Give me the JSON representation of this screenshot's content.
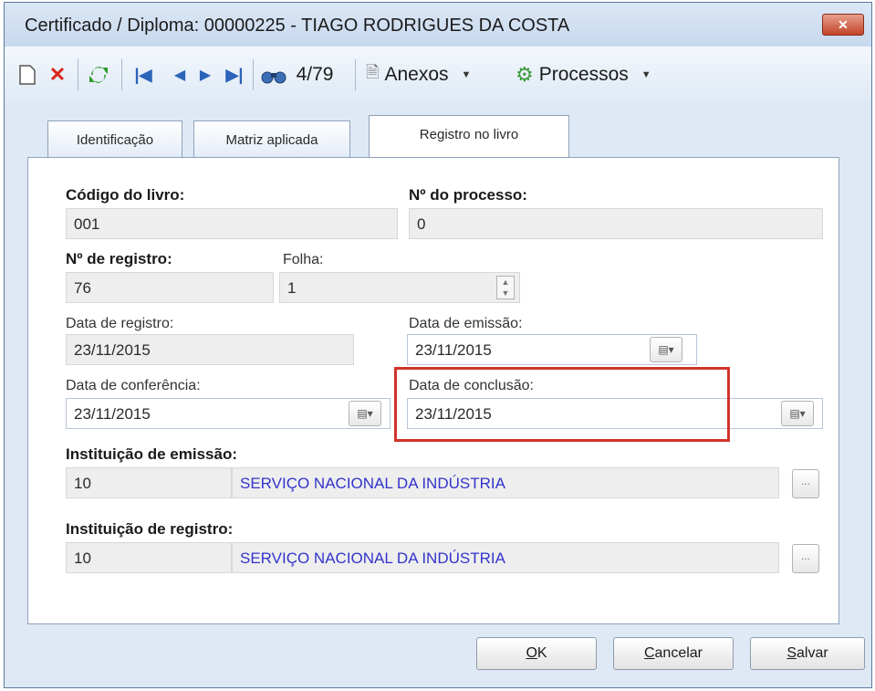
{
  "window": {
    "title": "Certificado / Diploma: 00000225 - TIAGO RODRIGUES DA COSTA",
    "close_label": "✕"
  },
  "toolbar": {
    "icons": [
      "new-document-icon",
      "delete-icon",
      "refresh-icon",
      "first-record-icon",
      "previous-record-icon",
      "next-record-icon",
      "last-record-icon",
      "binoculars-icon"
    ],
    "record_counter": "4/79",
    "attachments_label": "Anexos",
    "processes_label": "Processos"
  },
  "tabs": [
    {
      "label": "Identificação",
      "active": false
    },
    {
      "label": "Matriz aplicada",
      "active": false
    },
    {
      "label": "Registro no livro",
      "active": true
    }
  ],
  "form": {
    "book_code": {
      "label": "Código do livro:",
      "value": "001"
    },
    "process_number": {
      "label": "Nº do processo:",
      "value": "0"
    },
    "registration_number": {
      "label": "Nº de registro:",
      "value": "76"
    },
    "sheet": {
      "label": "Folha:",
      "value": "1"
    },
    "registration_date": {
      "label": "Data de registro:",
      "value": "23/11/2015"
    },
    "issue_date": {
      "label": "Data de emissão:",
      "value": "23/11/2015"
    },
    "check_date": {
      "label": "Data de conferência:",
      "value": "23/11/2015"
    },
    "completion_date": {
      "label": "Data de conclusão:",
      "value": "23/11/2015"
    },
    "issuing_institution": {
      "label": "Instituição de emissão:",
      "code": "10",
      "name": "SERVIÇO NACIONAL DA INDÚSTRIA"
    },
    "registering_institution": {
      "label": "Instituição de registro:",
      "code": "10",
      "name": "SERVIÇO NACIONAL DA INDÚSTRIA"
    }
  },
  "buttons": {
    "ok_mnemonic": "O",
    "ok_rest": "K",
    "cancel_mnemonic": "C",
    "cancel_rest": "ancelar",
    "save_mnemonic": "S",
    "save_rest": "alvar"
  },
  "colors": {
    "highlight": "#d0342c",
    "link": "#3333cc"
  }
}
